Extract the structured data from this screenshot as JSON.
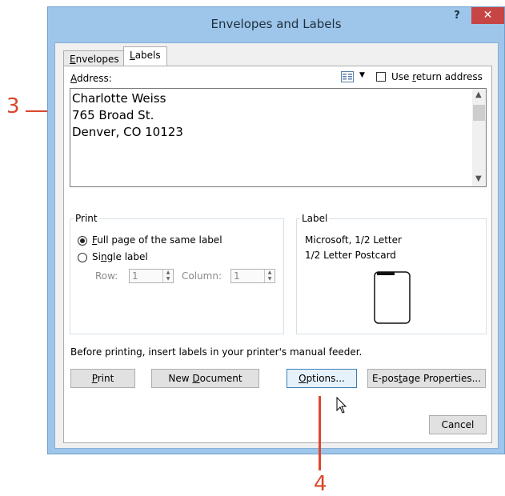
{
  "window": {
    "title": "Envelopes and Labels",
    "help": "?",
    "close": "✕"
  },
  "tabs": [
    {
      "label_u": "E",
      "label_rest": "nvelopes"
    },
    {
      "label_u": "L",
      "label_rest": "abels"
    }
  ],
  "address": {
    "label_u": "A",
    "label_rest": "ddress:",
    "text": "Charlotte Weiss\n765 Broad St.\nDenver, CO 10123",
    "use_return_pre": "Use ",
    "use_return_u": "r",
    "use_return_rest": "eturn address",
    "dropdown_arrow": "▼"
  },
  "print_group": {
    "legend": "Print",
    "full_page_u": "F",
    "full_page_rest": "ull page of the same label",
    "single_pre": "Si",
    "single_u": "n",
    "single_rest": "gle label",
    "row_label": "Row:",
    "row_value": "1",
    "column_label": "Column:",
    "column_value": "1"
  },
  "label_group": {
    "legend": "Label",
    "vendor": "Microsoft, 1/2 Letter",
    "product": "1/2 Letter Postcard"
  },
  "notice": "Before printing, insert labels in your printer's manual feeder.",
  "buttons": {
    "print_u": "P",
    "print_rest": "rint",
    "new_doc_pre": "New ",
    "new_doc_u": "D",
    "new_doc_rest": "ocument",
    "options_u": "O",
    "options_rest": "ptions...",
    "epostage_pre": "E-pos",
    "epostage_u": "t",
    "epostage_rest": "age Properties...",
    "cancel": "Cancel"
  },
  "annotations": {
    "a3": "3",
    "a4": "4"
  },
  "colors": {
    "annotation": "#d9472b",
    "titlebar": "#9dc6ea",
    "close": "#c74545"
  }
}
